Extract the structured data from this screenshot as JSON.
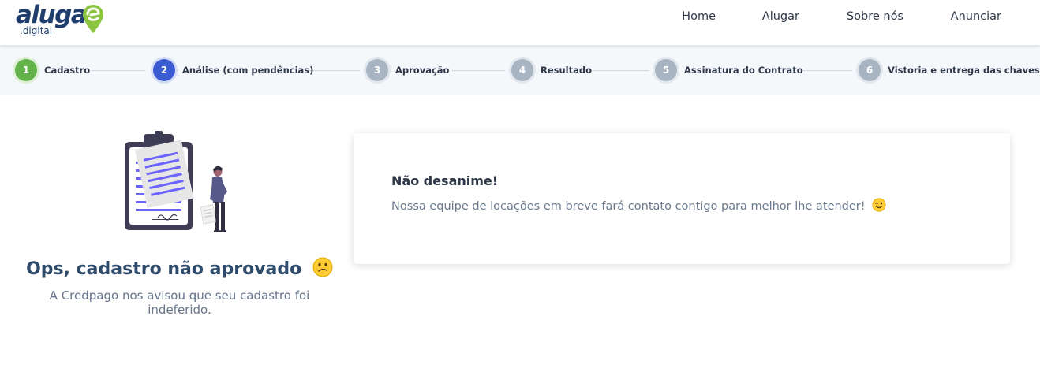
{
  "brand": {
    "name": "aluga",
    "sub": ".digital",
    "colors": {
      "navy": "#1f3e6e",
      "green": "#8cc540"
    }
  },
  "nav": {
    "items": [
      {
        "label": "Home"
      },
      {
        "label": "Alugar"
      },
      {
        "label": "Sobre nós"
      },
      {
        "label": "Anunciar"
      }
    ]
  },
  "stepper": {
    "steps": [
      {
        "num": "1",
        "label": "Cadastro",
        "state": "completed",
        "color": "#63b34a"
      },
      {
        "num": "2",
        "label": "Análise (com pendências)",
        "state": "current",
        "color": "#3a5bd1"
      },
      {
        "num": "3",
        "label": "Aprovação",
        "state": "pending",
        "color": "#a9b4c2"
      },
      {
        "num": "4",
        "label": "Resultado",
        "state": "pending",
        "color": "#a9b4c2"
      },
      {
        "num": "5",
        "label": "Assinatura do Contrato",
        "state": "pending",
        "color": "#a9b4c2"
      },
      {
        "num": "6",
        "label": "Vistoria e entrega das chaves",
        "state": "pending",
        "color": "#a9b4c2"
      }
    ]
  },
  "result": {
    "title": "Ops, cadastro não aprovado",
    "title_emoji": "confused-face-emoji",
    "description": "A Credpago nos avisou que seu cadastro foi indeferido."
  },
  "card": {
    "title": "Não desanime!",
    "text": "Nossa equipe de locações em breve fará contato contigo para melhor lhe atender!",
    "text_emoji": "winking-face-emoji"
  }
}
